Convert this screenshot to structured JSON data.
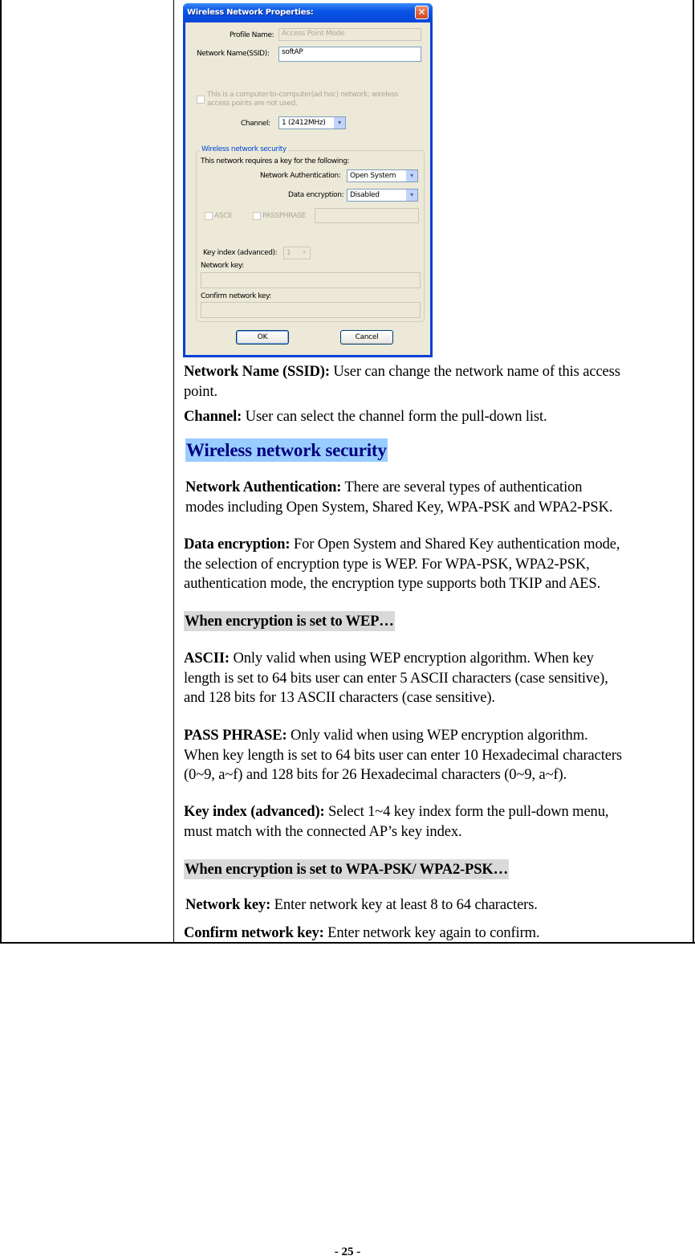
{
  "dialog": {
    "title": "Wireless Network Properties:",
    "close_glyph": "✕",
    "profile_name_label": "Profile Name:",
    "profile_name_value": "Access Point Mode",
    "ssid_label": "Network Name(SSID):",
    "ssid_value": "softAP",
    "adhoc_checkbox_label_line1": "This is a computer-to-computer(ad hoc) network; wireless",
    "adhoc_checkbox_label_line2": "access points are not used.",
    "adhoc_checked": false,
    "channel_label": "Channel:",
    "channel_value": "1  (2412MHz)",
    "security_group_title": "Wireless network security",
    "requires_key_text": "This network requires a key for the following:",
    "auth_label": "Network Authentication:",
    "auth_value": "Open System",
    "encryption_label": "Data encryption:",
    "encryption_value": "Disabled",
    "ascii_label": "ASCII",
    "passphrase_label": "PASSPHRASE",
    "passphrase_value": "",
    "key_index_label": "Key index (advanced):",
    "key_index_value": "1",
    "network_key_label": "Network key:",
    "network_key_value": "",
    "confirm_key_label": "Confirm network key:",
    "confirm_key_value": "",
    "ok_label": "OK",
    "cancel_label": "Cancel",
    "dropdown_arrow": "▾"
  },
  "content": {
    "ssid": {
      "term": "Network Name (SSID):",
      "desc_line1": " User can change the network name of this access",
      "desc_line2": "point."
    },
    "channel": {
      "term": "Channel:",
      "desc": " User can select the channel form the pull-down list."
    },
    "security_heading": "Wireless network security",
    "auth": {
      "term": "Network Authentication:",
      "desc_line1": " There are several types of authentication",
      "desc_line2": "modes including Open System, Shared Key, WPA-PSK and WPA2-PSK."
    },
    "encryption": {
      "term": "Data encryption:",
      "desc_line1": " For Open System and Shared Key authentication mode,",
      "desc_line2": "the selection of encryption type is WEP. For WPA-PSK, WPA2-PSK,",
      "desc_line3": "authentication mode, the encryption type supports both TKIP and AES."
    },
    "wep_heading": "When encryption is set to WEP…",
    "ascii": {
      "term": "ASCII:",
      "desc_line1": " Only valid when using WEP encryption algorithm. When key",
      "desc_line2": "length is set to 64 bits user can enter 5 ASCII characters (case sensitive),",
      "desc_line3": "and 128 bits for 13 ASCII characters (case sensitive)."
    },
    "passphrase": {
      "term": "PASS PHRASE:",
      "desc_line1": " Only valid when using WEP encryption algorithm.",
      "desc_line2": "When key length is set to 64 bits user can enter 10 Hexadecimal characters",
      "desc_line3": "(0~9, a~f) and 128 bits for 26 Hexadecimal characters (0~9, a~f)."
    },
    "key_index": {
      "term": "Key index (advanced):",
      "desc_line1": " Select 1~4 key index form the pull-down menu,",
      "desc_line2": "must match with the connected AP’s key index."
    },
    "wpa_heading": "When encryption is set to WPA-PSK/ WPA2-PSK…",
    "network_key": {
      "term": "Network key:",
      "desc": " Enter network key at least 8 to 64 characters."
    },
    "confirm_key": {
      "term": "Confirm network key:",
      "desc": " Enter network key again to confirm."
    }
  },
  "footer": {
    "page_number": "- 25 -"
  }
}
